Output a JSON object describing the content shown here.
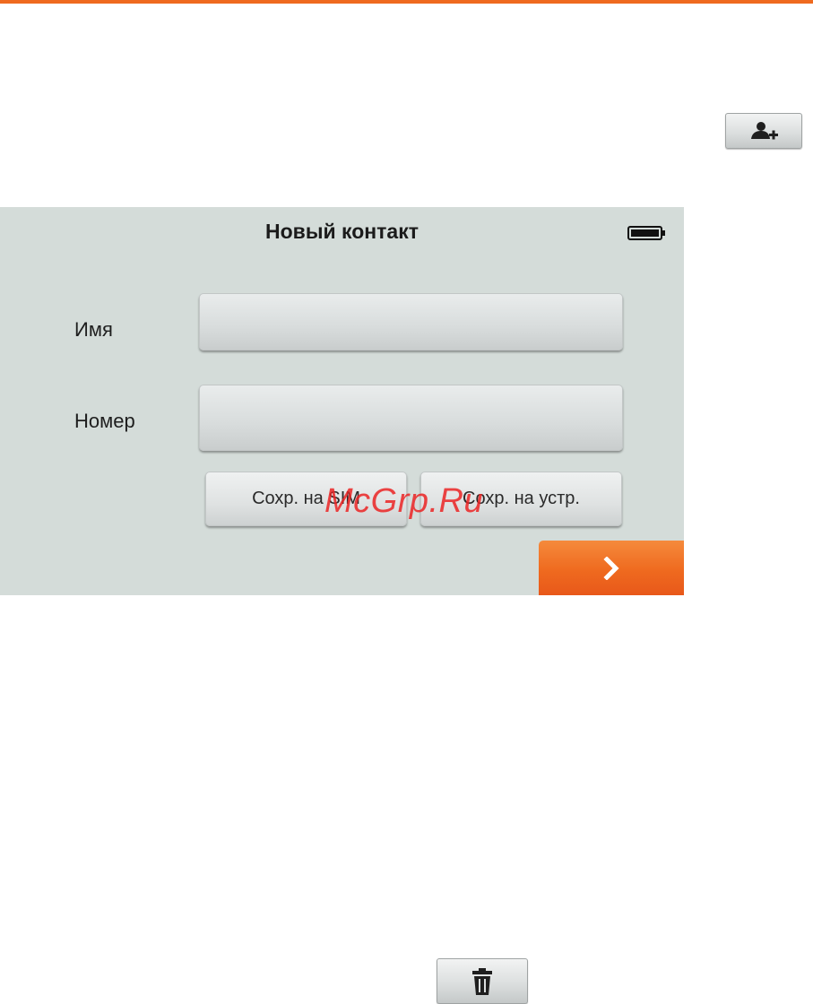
{
  "accent_color": "#ef6a1f",
  "screen": {
    "title": "Новый контакт",
    "battery": "battery-full-icon",
    "fields": {
      "name_label": "Имя",
      "name_value": "",
      "number_label": "Номер",
      "number_value": ""
    },
    "buttons": {
      "save_sim": "Сохр. на SIM",
      "save_device": "Сохр. на устр.",
      "next_icon": "chevron-right-icon"
    }
  },
  "icons": {
    "add_contact": "add-contact-icon",
    "delete": "trash-icon"
  },
  "watermark": "McGrp.Ru"
}
